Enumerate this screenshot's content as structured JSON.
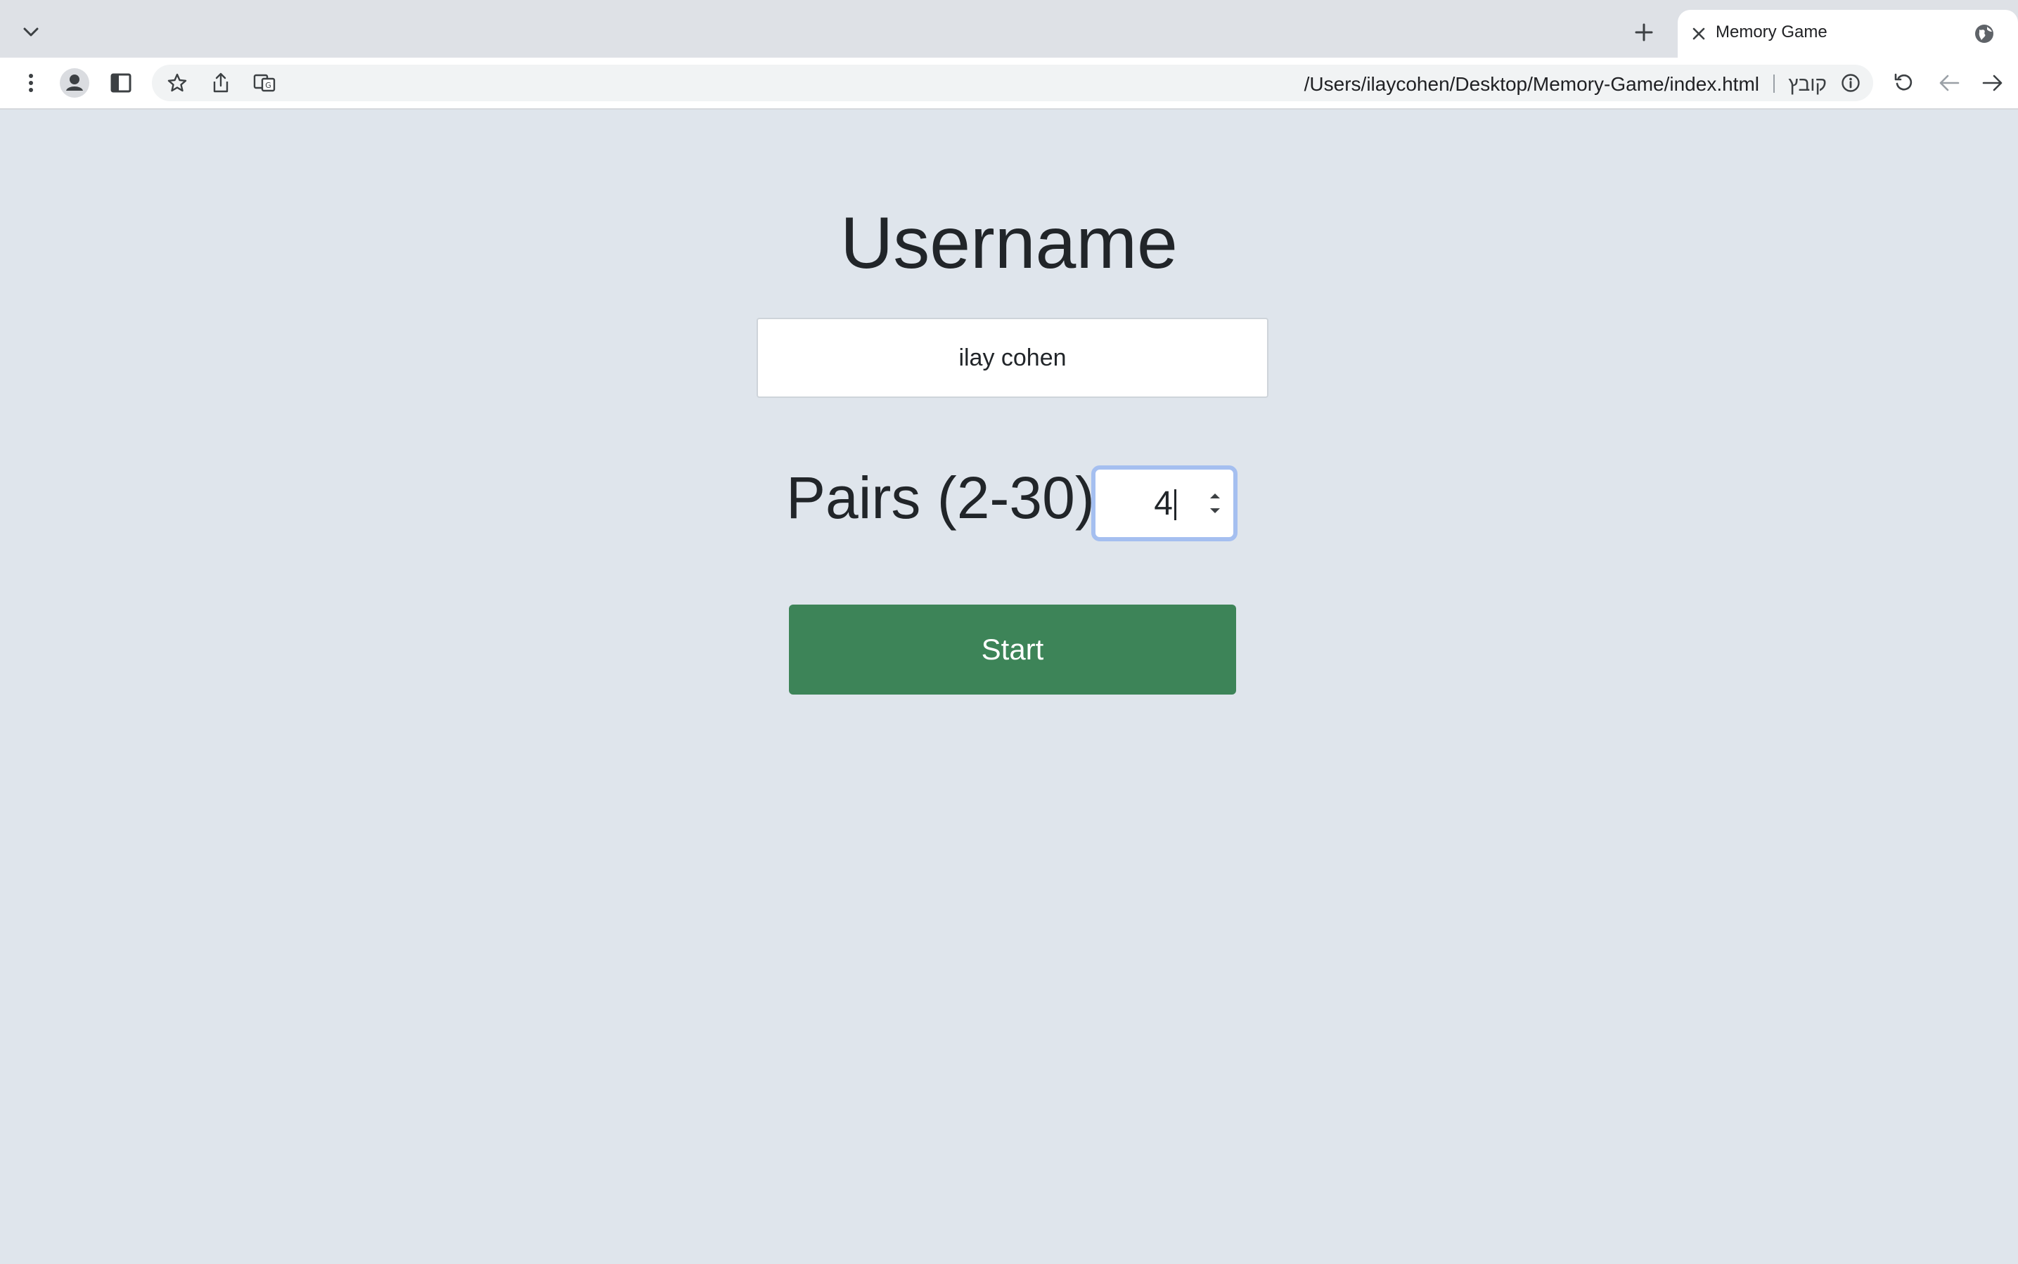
{
  "browser": {
    "tab": {
      "title": "Memory Game"
    },
    "omnibox": {
      "url": "/Users/ilaycohen/Desktop/Memory-Game/index.html",
      "scheme_label": "קובץ"
    }
  },
  "page": {
    "heading": "Username",
    "username": {
      "value": "ilay cohen"
    },
    "pairs": {
      "label": "Pairs (2-30):",
      "value": "4"
    },
    "start_label": "Start"
  },
  "colors": {
    "page_background": "#dfe5ec",
    "start_button": "#3d8458",
    "focus_ring": "#a5bff0"
  }
}
